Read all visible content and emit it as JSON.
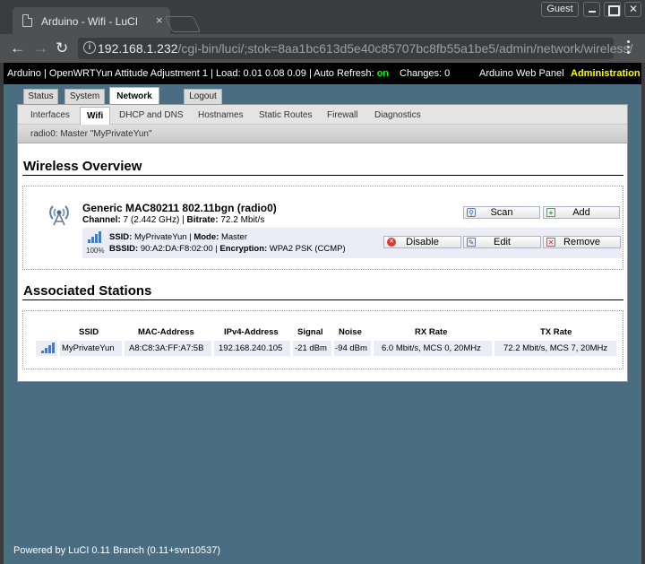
{
  "browser": {
    "tab_title": "Arduino - Wifi - LuCI",
    "tab_close": "×",
    "guest_label": "Guest",
    "url_host": "192.168.1.232",
    "url_path": "/cgi-bin/luci/;stok=8aa1bc613d5e40c85707bc8fb55a1be5/admin/network/wireless/"
  },
  "topbar": {
    "system_text": "Arduino | OpenWRTYun Attitude Adjustment 1 | Load: 0.01 0.08 0.09 | Auto Refresh: ",
    "auto_refresh_state": "on",
    "changes": "Changes: 0",
    "panel_link": "Arduino Web Panel",
    "admin_link": "Administration"
  },
  "main_tabs": [
    "Status",
    "System",
    "Network",
    "Logout"
  ],
  "sub_tabs": [
    "Interfaces",
    "Wifi",
    "DHCP and DNS",
    "Hostnames",
    "Static Routes",
    "Firewall",
    "Diagnostics"
  ],
  "radio_bar": "radio0: Master \"MyPrivateYun\"",
  "wireless": {
    "heading": "Wireless Overview",
    "device_title": "Generic MAC80211 802.11bgn (radio0)",
    "channel_label": "Channel:",
    "channel_value": " 7 (2.442 GHz) | ",
    "bitrate_label": "Bitrate:",
    "bitrate_value": " 72.2 Mbit/s",
    "signal_pct": "100%",
    "ssid_label": "SSID:",
    "ssid_value": " MyPrivateYun | ",
    "mode_label": "Mode:",
    "mode_value": " Master",
    "bssid_label": "BSSID:",
    "bssid_value": " 90:A2:DA:F8:02:00 | ",
    "enc_label": "Encryption:",
    "enc_value": " WPA2 PSK (CCMP)",
    "buttons": {
      "scan": "Scan",
      "add": "Add",
      "disable": "Disable",
      "edit": "Edit",
      "remove": "Remove"
    }
  },
  "stations": {
    "heading": "Associated Stations",
    "columns": [
      "SSID",
      "MAC-Address",
      "IPv4-Address",
      "Signal",
      "Noise",
      "RX Rate",
      "TX Rate"
    ],
    "rows": [
      {
        "ssid": "MyPrivateYun",
        "mac": "A8:C8:3A:FF:A7:5B",
        "ipv4": "192.168.240.105",
        "signal": "-21 dBm",
        "noise": "-94 dBm",
        "rx": "6.0 Mbit/s, MCS 0, 20MHz",
        "tx": "72.2 Mbit/s, MCS 7, 20MHz"
      }
    ]
  },
  "footer": "Powered by LuCI 0.11 Branch (0.11+svn10537)"
}
